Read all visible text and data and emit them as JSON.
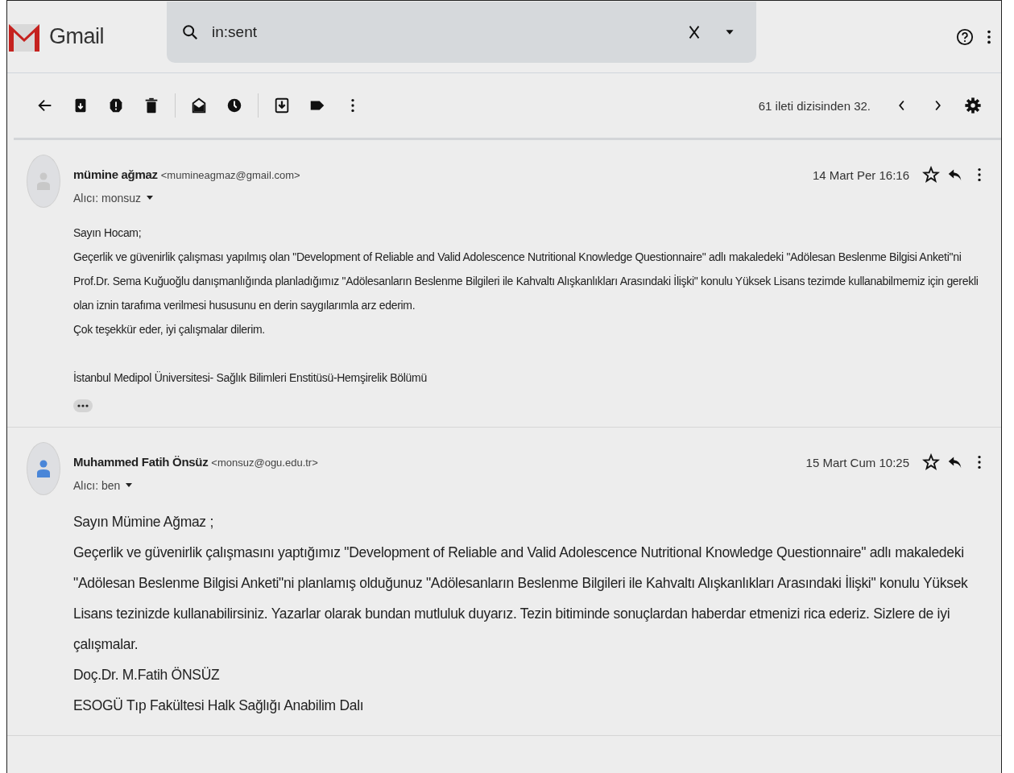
{
  "header": {
    "app_name": "Gmail",
    "search": {
      "value": "in:sent"
    }
  },
  "toolbar": {
    "pagination": "61 ileti dizisinden 32."
  },
  "messages": [
    {
      "sender": "mümine ağmaz",
      "email": "<mumineagmaz@gmail.com>",
      "recipient": "Alıcı: monsuz",
      "date": "14 Mart Per 16:16",
      "color": "#c8c8c8",
      "kind": "compact",
      "body": [
        "Sayın Hocam;",
        "Geçerlik ve güvenirlik çalışması yapılmış olan \"Development of Reliable and Valid Adolescence Nutritional Knowledge Questionnaire\" adlı makaledeki \"Adölesan Beslenme Bilgisi Anketi\"ni Prof.Dr. Sema Kuğuoğlu danışmanlığında planladığımız \"Adölesanların Beslenme Bilgileri ile Kahvaltı Alışkanlıkları Arasındaki İlişki\" konulu Yüksek Lisans tezimde kullanabilmemiz için gerekli olan iznin tarafıma verilmesi hususunu en derin saygılarımla arz ederim.",
        "Çok teşekkür eder, iyi çalışmalar dilerim."
      ],
      "signature": [
        "İstanbul Medipol Üniversitesi- Sağlık Bilimleri Enstitüsü-Hemşirelik Bölümü"
      ],
      "trimmed": true
    },
    {
      "sender": "Muhammed Fatih Önsüz",
      "email": "<monsuz@ogu.edu.tr>",
      "recipient": "Alıcı: ben",
      "date": "15 Mart Cum 10:25",
      "color": "#4a86d8",
      "kind": "large",
      "body": [
        "Sayın Mümine Ağmaz ;",
        "Geçerlik ve güvenirlik çalışmasını yaptığımız \"Development of Reliable and Valid Adolescence Nutritional Knowledge Questionnaire\" adlı makaledeki \"Adölesan Beslenme Bilgisi Anketi\"ni planlamış olduğunuz \"Adölesanların Beslenme Bilgileri ile Kahvaltı Alışkanlıkları Arasındaki İlişki\" konulu Yüksek Lisans tezinizde kullanabilirsiniz. Yazarlar olarak bundan mutluluk duyarız. Tezin bitiminde sonuçlardan haberdar etmenizi rica ederiz. Sizlere de iyi çalışmalar.",
        "Doç.Dr. M.Fatih ÖNSÜZ",
        "ESOGÜ Tıp Fakültesi Halk Sağlığı Anabilim Dalı"
      ],
      "trimmed": false
    }
  ]
}
